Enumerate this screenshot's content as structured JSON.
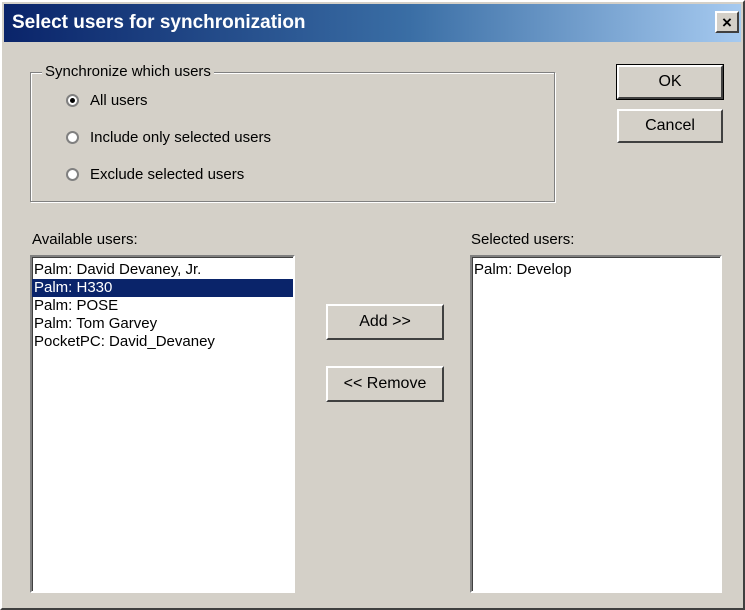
{
  "window": {
    "title": "Select users for synchronization",
    "close_symbol": "×"
  },
  "sync_group": {
    "legend": "Synchronize which users",
    "options": [
      {
        "label": "All users",
        "checked": true
      },
      {
        "label": "Include only selected users",
        "checked": false
      },
      {
        "label": "Exclude selected users",
        "checked": false
      }
    ]
  },
  "buttons": {
    "ok": "OK",
    "cancel": "Cancel",
    "add": "Add >>",
    "remove": "<< Remove"
  },
  "available": {
    "label": "Available users:",
    "items": [
      {
        "text": "Palm: David Devaney, Jr.",
        "selected": false
      },
      {
        "text": "Palm: H330",
        "selected": true
      },
      {
        "text": "Palm: POSE",
        "selected": false
      },
      {
        "text": "Palm: Tom Garvey",
        "selected": false
      },
      {
        "text": "PocketPC: David_Devaney",
        "selected": false
      }
    ]
  },
  "selected": {
    "label": "Selected users:",
    "items": [
      {
        "text": "Palm: Develop",
        "selected": false
      }
    ]
  },
  "colors": {
    "dialog_face": "#d4d0c8",
    "title_start": "#0a246a",
    "title_end": "#a6caf0",
    "selection": "#0a246a"
  }
}
